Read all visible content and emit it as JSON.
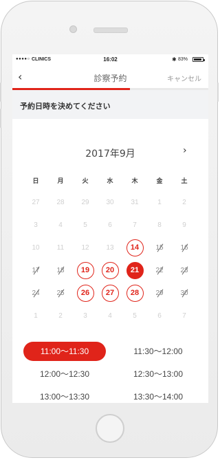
{
  "status_bar": {
    "signal": "●●●●○",
    "carrier": "CLINICS",
    "time": "16:02",
    "bluetooth_icon": "bluetooth-icon",
    "battery_percent": "83%",
    "battery_level": 0.83
  },
  "nav": {
    "back_icon": "‹",
    "title": "診察予約",
    "cancel": "キャンセル",
    "progress_fraction": 0.6
  },
  "section": {
    "heading": "予約日時を決めてください"
  },
  "calendar": {
    "month_label": "2017年9月",
    "next_icon": "›",
    "weekdays": [
      "日",
      "月",
      "火",
      "水",
      "木",
      "金",
      "土"
    ],
    "days": [
      {
        "label": "27",
        "state": "off"
      },
      {
        "label": "28",
        "state": "off"
      },
      {
        "label": "29",
        "state": "off"
      },
      {
        "label": "30",
        "state": "off"
      },
      {
        "label": "31",
        "state": "off"
      },
      {
        "label": "1",
        "state": "off"
      },
      {
        "label": "2",
        "state": "off"
      },
      {
        "label": "3",
        "state": "off"
      },
      {
        "label": "4",
        "state": "off"
      },
      {
        "label": "5",
        "state": "off"
      },
      {
        "label": "6",
        "state": "off"
      },
      {
        "label": "7",
        "state": "off"
      },
      {
        "label": "8",
        "state": "off"
      },
      {
        "label": "9",
        "state": "off"
      },
      {
        "label": "10",
        "state": "off"
      },
      {
        "label": "11",
        "state": "off"
      },
      {
        "label": "12",
        "state": "off"
      },
      {
        "label": "13",
        "state": "off"
      },
      {
        "label": "14",
        "state": "avail"
      },
      {
        "label": "15",
        "state": "struck"
      },
      {
        "label": "16",
        "state": "struck"
      },
      {
        "label": "17",
        "state": "struck"
      },
      {
        "label": "18",
        "state": "struck"
      },
      {
        "label": "19",
        "state": "avail"
      },
      {
        "label": "20",
        "state": "avail"
      },
      {
        "label": "21",
        "state": "selected"
      },
      {
        "label": "22",
        "state": "struck"
      },
      {
        "label": "23",
        "state": "struck"
      },
      {
        "label": "24",
        "state": "struck"
      },
      {
        "label": "25",
        "state": "struck"
      },
      {
        "label": "26",
        "state": "avail"
      },
      {
        "label": "27",
        "state": "avail"
      },
      {
        "label": "28",
        "state": "avail"
      },
      {
        "label": "29",
        "state": "struck"
      },
      {
        "label": "30",
        "state": "struck"
      },
      {
        "label": "1",
        "state": "off"
      },
      {
        "label": "2",
        "state": "off"
      },
      {
        "label": "3",
        "state": "off"
      },
      {
        "label": "4",
        "state": "off"
      },
      {
        "label": "5",
        "state": "off"
      },
      {
        "label": "6",
        "state": "off"
      },
      {
        "label": "7",
        "state": "off"
      }
    ]
  },
  "time_slots": [
    {
      "label": "11:00〜11:30",
      "selected": true
    },
    {
      "label": "11:30〜12:00",
      "selected": false
    },
    {
      "label": "12:00〜12:30",
      "selected": false
    },
    {
      "label": "12:30〜13:00",
      "selected": false
    },
    {
      "label": "13:00〜13:30",
      "selected": false
    },
    {
      "label": "13:30〜14:00",
      "selected": false
    }
  ],
  "colors": {
    "accent": "#e0241a",
    "muted": "#cfcfcf",
    "text": "#444444",
    "section_bg": "#f2f3f5"
  }
}
